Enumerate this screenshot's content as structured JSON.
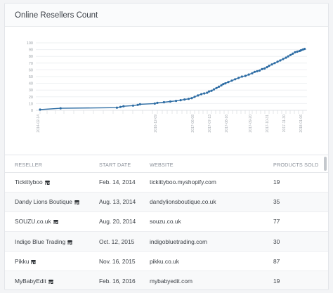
{
  "card": {
    "title": "Online Resellers Count"
  },
  "chart_data": {
    "type": "line",
    "title": "",
    "xlabel": "",
    "ylabel": "",
    "ylim": [
      0,
      100
    ],
    "y_ticks": [
      0,
      10,
      20,
      30,
      40,
      50,
      60,
      70,
      80,
      90,
      100
    ],
    "x_tick_labels": [
      "2014-02-14",
      "2016-12-09",
      "2017-06-08",
      "2017-07-13",
      "2017-08-16",
      "2017-09-20",
      "2017-10-31",
      "2017-11-30",
      "2018-01-06"
    ],
    "x_tick_dates": [
      "2014-02-14",
      "2016-12-09",
      "2017-06-08",
      "2017-07-13",
      "2017-08-16",
      "2017-09-20",
      "2017-10-31",
      "2017-11-30",
      "2018-01-06"
    ],
    "series": [
      {
        "color": "#2e6da4",
        "points": [
          [
            "2014-02-14",
            1
          ],
          [
            "2014-08-13",
            3
          ],
          [
            "2015-12-20",
            4
          ],
          [
            "2016-01-20",
            5
          ],
          [
            "2016-02-16",
            6
          ],
          [
            "2016-05-10",
            7
          ],
          [
            "2016-06-20",
            8
          ],
          [
            "2016-07-10",
            9
          ],
          [
            "2016-11-16",
            10
          ],
          [
            "2016-12-09",
            11
          ],
          [
            "2017-01-10",
            12
          ],
          [
            "2017-02-10",
            13
          ],
          [
            "2017-03-10",
            14
          ],
          [
            "2017-04-01",
            15
          ],
          [
            "2017-04-20",
            16
          ],
          [
            "2017-05-10",
            17
          ],
          [
            "2017-05-25",
            18
          ],
          [
            "2017-06-08",
            20
          ],
          [
            "2017-06-15",
            22
          ],
          [
            "2017-06-22",
            24
          ],
          [
            "2017-06-28",
            25
          ],
          [
            "2017-07-04",
            26
          ],
          [
            "2017-07-08",
            28
          ],
          [
            "2017-07-13",
            29
          ],
          [
            "2017-07-18",
            31
          ],
          [
            "2017-07-23",
            33
          ],
          [
            "2017-07-28",
            35
          ],
          [
            "2017-08-02",
            37
          ],
          [
            "2017-08-06",
            39
          ],
          [
            "2017-08-10",
            40
          ],
          [
            "2017-08-16",
            42
          ],
          [
            "2017-08-21",
            44
          ],
          [
            "2017-08-26",
            46
          ],
          [
            "2017-08-31",
            48
          ],
          [
            "2017-09-05",
            50
          ],
          [
            "2017-09-10",
            51
          ],
          [
            "2017-09-15",
            53
          ],
          [
            "2017-09-20",
            55
          ],
          [
            "2017-09-26",
            57
          ],
          [
            "2017-10-02",
            58
          ],
          [
            "2017-10-08",
            59
          ],
          [
            "2017-10-14",
            61
          ],
          [
            "2017-10-20",
            62
          ],
          [
            "2017-10-26",
            64
          ],
          [
            "2017-10-31",
            66
          ],
          [
            "2017-11-05",
            68
          ],
          [
            "2017-11-10",
            70
          ],
          [
            "2017-11-15",
            72
          ],
          [
            "2017-11-20",
            74
          ],
          [
            "2017-11-25",
            76
          ],
          [
            "2017-11-30",
            78
          ],
          [
            "2017-12-05",
            80
          ],
          [
            "2017-12-10",
            82
          ],
          [
            "2017-12-15",
            84
          ],
          [
            "2017-12-20",
            86
          ],
          [
            "2017-12-25",
            87
          ],
          [
            "2017-12-30",
            88
          ],
          [
            "2018-01-02",
            89
          ],
          [
            "2018-01-06",
            90
          ],
          [
            "2018-01-10",
            91
          ]
        ]
      }
    ],
    "grid": true,
    "legend": "none"
  },
  "table": {
    "headers": [
      "RESELLER",
      "START DATE",
      "WEBSITE",
      "PRODUCTS SOLD"
    ],
    "rows": [
      {
        "reseller": "Tickittyboo",
        "start": "Feb. 14, 2014",
        "website": "tickittyboo.myshopify.com",
        "sold": "19"
      },
      {
        "reseller": "Dandy Lions Boutique",
        "start": "Aug. 13, 2014",
        "website": "dandylionsboutique.co.uk",
        "sold": "35"
      },
      {
        "reseller": "SOUZU.co.uk",
        "start": "Aug. 20, 2014",
        "website": "souzu.co.uk",
        "sold": "77"
      },
      {
        "reseller": "Indigo Blue Trading",
        "start": "Oct. 12, 2015",
        "website": "indigobluetrading.com",
        "sold": "30"
      },
      {
        "reseller": "Pikku",
        "start": "Nov. 16, 2015",
        "website": "pikku.co.uk",
        "sold": "87"
      },
      {
        "reseller": "MyBabyEdit",
        "start": "Feb. 16, 2016",
        "website": "mybabyedit.com",
        "sold": "19"
      }
    ],
    "row_icon": "shop-icon"
  }
}
